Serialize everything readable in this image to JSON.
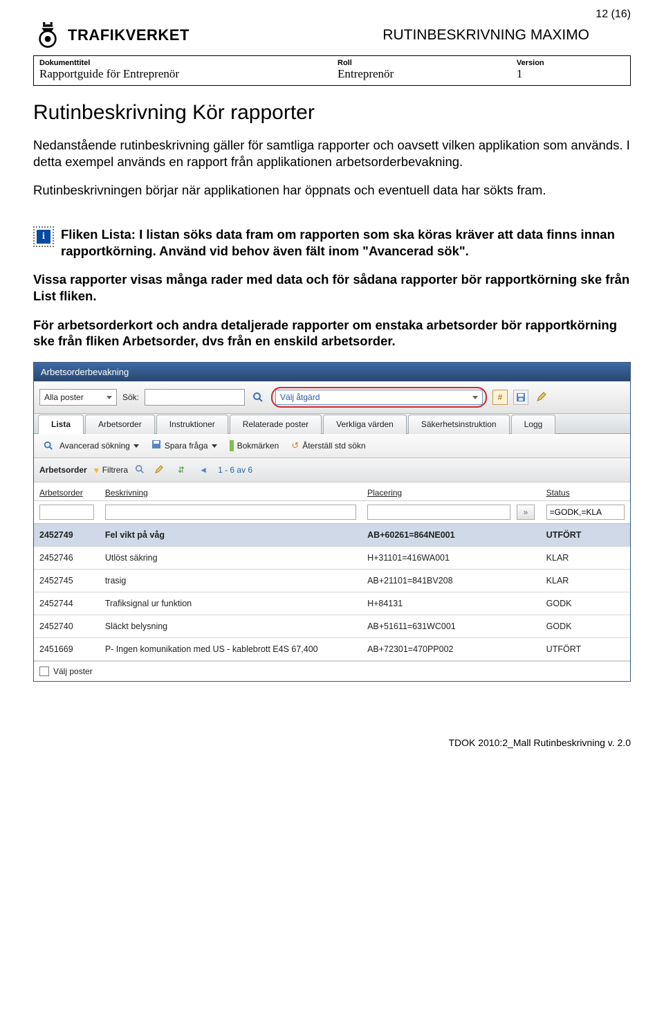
{
  "page_number": "12 (16)",
  "brand": "TRAFIKVERKET",
  "doc_top_title": "RUTINBESKRIVNING MAXIMO",
  "meta": {
    "title_label": "Dokumenttitel",
    "title_value": "Rapportguide för Entreprenör",
    "role_label": "Roll",
    "role_value": "Entreprenör",
    "version_label": "Version",
    "version_value": "1"
  },
  "h1": "Rutinbeskrivning Kör rapporter",
  "p1": "Nedanstående rutinbeskrivning gäller för samtliga rapporter och oavsett vilken applikation som används. I detta exempel används en rapport från applikationen arbetsorderbevakning.",
  "p2": "Rutinbeskrivningen börjar när applikationen har öppnats och eventuell data har sökts fram.",
  "info_glyph": "i",
  "info_text": "Fliken Lista: I listan söks data fram om rapporten som ska köras kräver att data finns innan rapportkörning. Använd vid behov även fält inom \"Avancerad sök\".",
  "bold1": "Vissa rapporter visas många rader med data och för sådana rapporter bör rapportkörning ske från List fliken.",
  "bold2": "För arbetsorderkort och andra detaljerade rapporter om enstaka arbetsorder bör rapportkörning ske från fliken Arbetsorder, dvs från en enskild arbetsorder.",
  "app": {
    "title": "Arbetsorderbevakning",
    "posts_combo": "Alla poster",
    "search_label": "Sök:",
    "search_value": "",
    "action_placeholder": "Välj åtgärd",
    "tabs": [
      "Lista",
      "Arbetsorder",
      "Instruktioner",
      "Relaterade poster",
      "Verkliga värden",
      "Säkerhetsinstruktion",
      "Logg"
    ],
    "subtoolbar": {
      "adv_search": "Avancerad sökning",
      "save_query": "Spara fråga",
      "bookmarks": "Bokmärken",
      "reset": "Återställ std sökn"
    },
    "filterbar": {
      "label": "Arbetsorder",
      "filter": "Filtrera",
      "range": "1 - 6 av 6"
    },
    "columns": {
      "ao": "Arbetsorder",
      "desc": "Beskrivning",
      "plac": "Placering",
      "status": "Status"
    },
    "status_filter_value": "=GODK,=KLA",
    "rows": [
      {
        "ao": "2452749",
        "desc": "Fel vikt på våg",
        "plac": "AB+60261=864NE001",
        "status": "UTFÖRT",
        "hl": true
      },
      {
        "ao": "2452746",
        "desc": "Utlöst säkring",
        "plac": "H+31101=416WA001",
        "status": "KLAR",
        "hl": false
      },
      {
        "ao": "2452745",
        "desc": "trasig",
        "plac": "AB+21101=841BV208",
        "status": "KLAR",
        "hl": false
      },
      {
        "ao": "2452744",
        "desc": "Trafiksignal ur funktion",
        "plac": "H+84131",
        "status": "GODK",
        "hl": false
      },
      {
        "ao": "2452740",
        "desc": "Släckt belysning",
        "plac": "AB+51611=631WC001",
        "status": "GODK",
        "hl": false
      },
      {
        "ao": "2451669",
        "desc": "P- Ingen komunikation med US - kablebrott E4S 67,400",
        "plac": "AB+72301=470PP002",
        "status": "UTFÖRT",
        "hl": false
      }
    ],
    "select_posts": "Välj poster"
  },
  "footer": "TDOK 2010:2_Mall Rutinbeskrivning v. 2.0"
}
